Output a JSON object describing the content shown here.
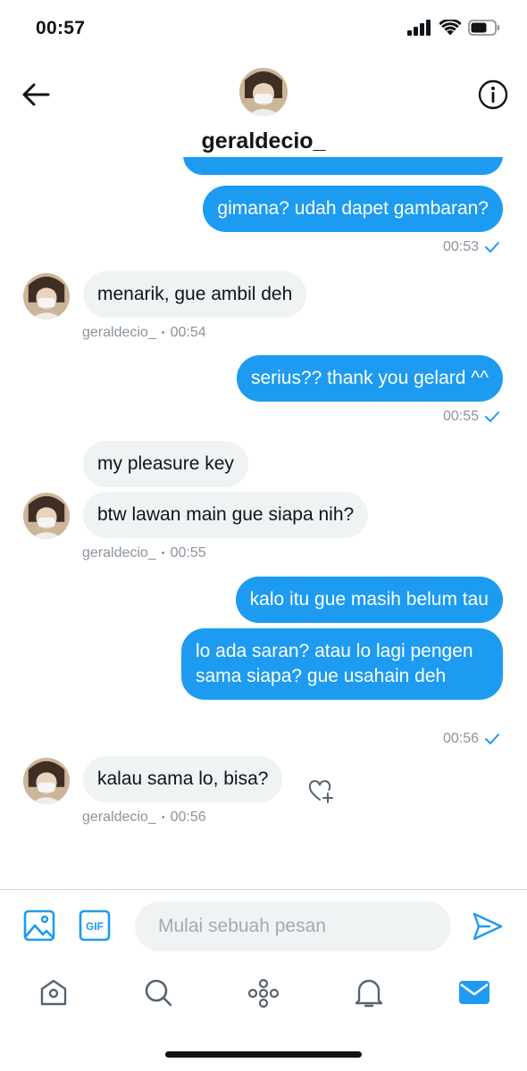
{
  "status_bar": {
    "time": "00:57"
  },
  "conversation": {
    "username": "geraldecio_"
  },
  "messages": {
    "m1": {
      "text": "gimana? udah dapet gambaran?",
      "time": "00:53"
    },
    "m2": {
      "text": "menarik, gue ambil deh",
      "sender": "geraldecio_",
      "time": "00:54"
    },
    "m3": {
      "text": "serius?? thank you gelard ^^",
      "time": "00:55"
    },
    "m4": {
      "text": "my pleasure key"
    },
    "m5": {
      "text": "btw lawan main gue siapa nih?",
      "sender": "geraldecio_",
      "time": "00:55"
    },
    "m6": {
      "text": "kalo itu gue masih belum tau"
    },
    "m7": {
      "text": "lo ada saran? atau lo lagi pengen sama siapa? gue usahain deh",
      "time": "00:56"
    },
    "m8": {
      "text": "kalau sama lo, bisa?",
      "sender": "geraldecio_",
      "time": "00:56"
    }
  },
  "composer": {
    "placeholder": "Mulai sebuah pesan",
    "gif_label": "GIF"
  },
  "colors": {
    "accent": "#1d9bf0",
    "incoming_bubble": "#eff3f4",
    "meta_text": "#8a949d"
  },
  "icons": {
    "back": "arrow-left-icon",
    "info": "info-icon",
    "media": "image-icon",
    "gif": "gif-icon",
    "send": "send-icon",
    "like": "heart-plus-icon",
    "tabs": [
      "home-icon",
      "search-icon",
      "spaces-icon",
      "notifications-icon",
      "messages-icon"
    ]
  }
}
